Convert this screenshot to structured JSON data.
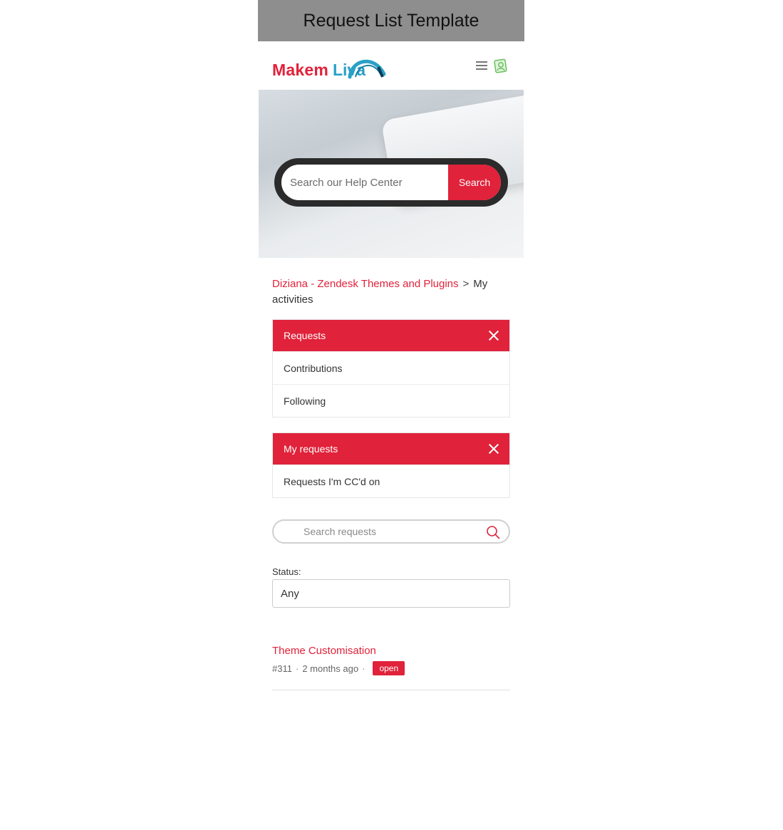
{
  "page": {
    "title": "Request List Template"
  },
  "brand": {
    "name_part1": "Makem",
    "name_part2": "Liva",
    "primary_color": "#e0223a",
    "secondary_color": "#2aa0c6"
  },
  "header": {
    "menu_icon": "hamburger-icon",
    "avatar_icon": "avatar-icon"
  },
  "hero": {
    "search_placeholder": "Search our Help Center",
    "search_button": "Search"
  },
  "breadcrumb": {
    "home": "Diziana - Zendesk Themes and Plugins",
    "separator": ">",
    "current": "My activities"
  },
  "activity_tabs": {
    "active": "Requests",
    "items": [
      "Contributions",
      "Following"
    ]
  },
  "request_tabs": {
    "active": "My requests",
    "items": [
      "Requests I'm CC'd on"
    ]
  },
  "request_search": {
    "placeholder": "Search requests"
  },
  "status_filter": {
    "label": "Status:",
    "value": "Any"
  },
  "requests": [
    {
      "title": "Theme Customisation",
      "id": "#311",
      "time": "2 months ago",
      "status": "open"
    }
  ]
}
